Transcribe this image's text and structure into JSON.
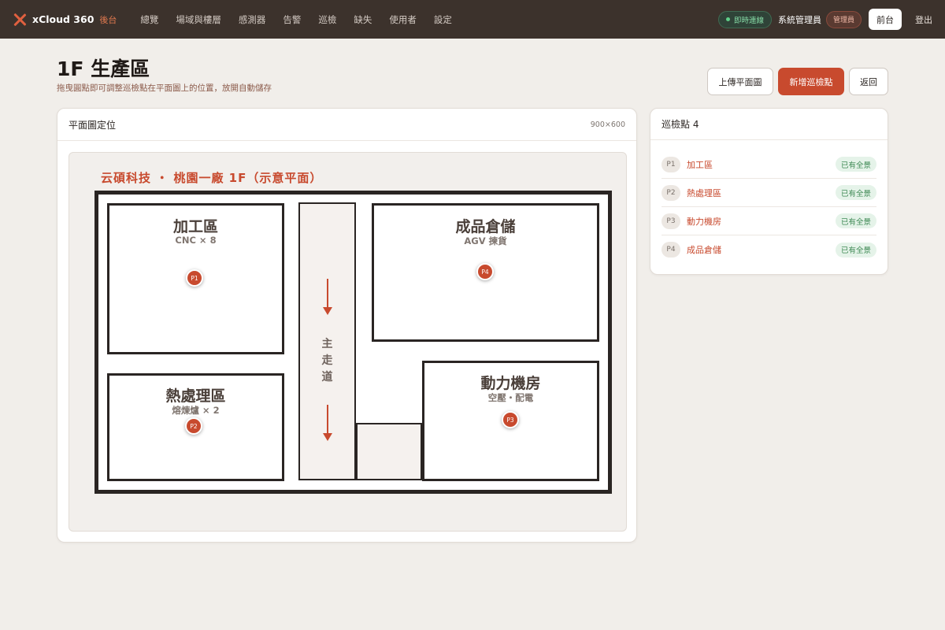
{
  "app": {
    "brand": "xCloud 360",
    "brand_sub": "後台",
    "nav": [
      "總覽",
      "場域與樓層",
      "感測器",
      "告警",
      "巡檢",
      "缺失",
      "使用者",
      "設定"
    ],
    "live_status": "即時連線",
    "user_name": "系統管理員",
    "user_role": "管理員",
    "front_label": "前台",
    "logout_label": "登出"
  },
  "page": {
    "title": "1F 生產區",
    "subtitle": "拖曳圓點即可調整巡檢點在平面圖上的位置，放開自動儲存",
    "actions": {
      "upload": "上傳平面圖",
      "add_point": "新增巡檢點",
      "back": "返回"
    }
  },
  "plan": {
    "card_title": "平面圖定位",
    "dimensions": "900×600",
    "image_title": "云碩科技 ・ 桃園一廠 1F（示意平面）",
    "corridor": "主\n走\n道",
    "rooms": [
      {
        "name": "加工區",
        "sub": "CNC × 8"
      },
      {
        "name": "成品倉儲",
        "sub": "AGV 揀貨"
      },
      {
        "name": "熱處理區",
        "sub": "熔煉爐 × 2"
      },
      {
        "name": "動力機房",
        "sub": "空壓・配電"
      }
    ],
    "pins": [
      "P1",
      "P2",
      "P3",
      "P4"
    ]
  },
  "points": {
    "title": "巡檢點 4",
    "items": [
      {
        "id": "P1",
        "name": "加工區",
        "status": "已有全景"
      },
      {
        "id": "P2",
        "name": "熱處理區",
        "status": "已有全景"
      },
      {
        "id": "P3",
        "name": "動力機房",
        "status": "已有全景"
      },
      {
        "id": "P4",
        "name": "成品倉儲",
        "status": "已有全景"
      }
    ]
  }
}
